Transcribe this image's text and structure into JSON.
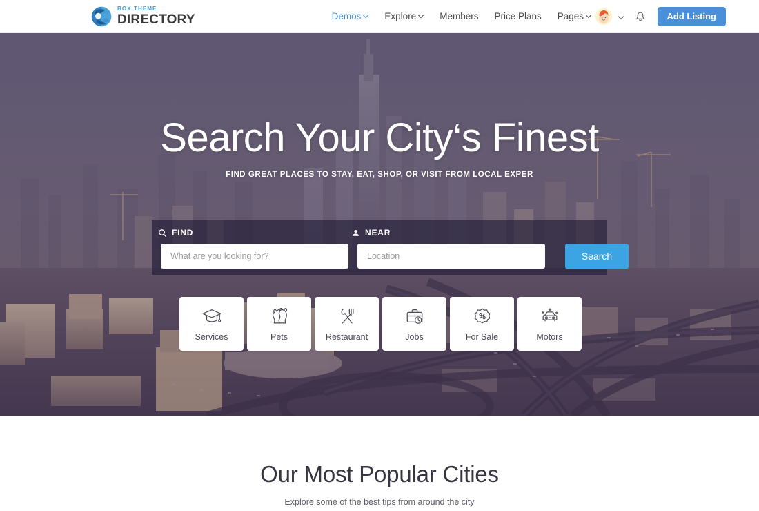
{
  "header": {
    "logo": {
      "icon": "globe-logo-icon",
      "top_text": "BOX THEME",
      "bottom_text": "DIRECTORY"
    },
    "nav": [
      {
        "label": "Demos",
        "has_chevron": true,
        "active": true
      },
      {
        "label": "Explore",
        "has_chevron": true,
        "active": false
      },
      {
        "label": "Members",
        "has_chevron": false,
        "active": false
      },
      {
        "label": "Price Plans",
        "has_chevron": false,
        "active": false
      },
      {
        "label": "Pages",
        "has_chevron": true,
        "active": false
      }
    ],
    "avatar_icon": "user-avatar",
    "avatar_chevron_icon": "chevron-down-icon",
    "notification_icon": "bell-icon",
    "add_listing_label": "Add Listing",
    "accent_color": "#4a90d9",
    "active_nav_color": "#4a90d9"
  },
  "hero": {
    "title": "Search Your City‘s Finest",
    "subtitle": "FIND GREAT PLACES TO STAY, EAT, SHOP, OR VISIT FROM LOCAL EXPER",
    "search": {
      "find_label": "FIND",
      "find_icon": "search-icon",
      "find_placeholder": "What are you looking for?",
      "find_value": "",
      "near_label": "NEAR",
      "near_icon": "location-pin-icon",
      "near_placeholder": "Location",
      "near_value": "",
      "button_label": "Search",
      "button_color": "#3ca4e3"
    },
    "categories": [
      {
        "label": "Services",
        "icon": "graduation-cap-icon"
      },
      {
        "label": "Pets",
        "icon": "pets-icon"
      },
      {
        "label": "Restaurant",
        "icon": "cutlery-icon"
      },
      {
        "label": "Jobs",
        "icon": "briefcase-clock-icon"
      },
      {
        "label": "For Sale",
        "icon": "percent-badge-icon"
      },
      {
        "label": "Motors",
        "icon": "car-icon"
      }
    ]
  },
  "cities_section": {
    "title": "Our Most Popular Cities",
    "subtitle": "Explore some of the best tips from around the city"
  }
}
